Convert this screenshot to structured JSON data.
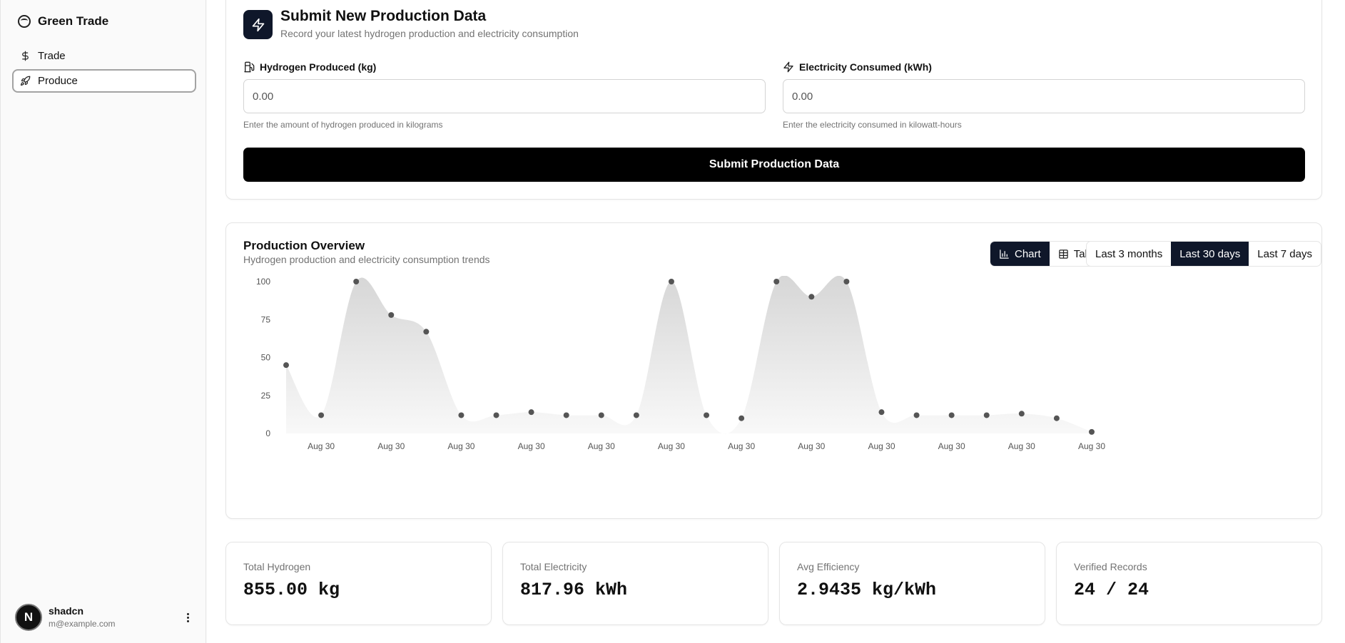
{
  "sidebar": {
    "brand": "Green Trade",
    "items": [
      {
        "label": "Trade",
        "icon": "dollar-icon"
      },
      {
        "label": "Produce",
        "icon": "rocket-icon",
        "active": true
      }
    ],
    "user": {
      "initial": "N",
      "name": "shadcn",
      "email": "m@example.com"
    }
  },
  "submit": {
    "title": "Submit New Production Data",
    "subtitle": "Record your latest hydrogen production and electricity consumption",
    "hydrogen": {
      "label": "Hydrogen Produced (kg)",
      "placeholder": "0.00",
      "help": "Enter the amount of hydrogen produced in kilograms"
    },
    "electricity": {
      "label": "Electricity Consumed (kWh)",
      "placeholder": "0.00",
      "help": "Enter the electricity consumed in kilowatt-hours"
    },
    "button": "Submit Production Data"
  },
  "overview": {
    "title": "Production Overview",
    "subtitle": "Hydrogen production and electricity consumption trends",
    "views": [
      {
        "label": "Chart",
        "active": true
      },
      {
        "label": "Table",
        "active": false
      }
    ],
    "ranges": [
      {
        "label": "Last 3 months",
        "active": false
      },
      {
        "label": "Last 30 days",
        "active": true
      },
      {
        "label": "Last 7 days",
        "active": false
      }
    ]
  },
  "chart_data": {
    "type": "area",
    "title": "",
    "xlabel": "",
    "ylabel": "",
    "ylim": [
      0,
      100
    ],
    "yticks": [
      0,
      25,
      50,
      75,
      100
    ],
    "x_tick_labels": [
      "Aug 30",
      "Aug 30",
      "Aug 30",
      "Aug 30",
      "Aug 30",
      "Aug 30",
      "Aug 30",
      "Aug 30",
      "Aug 30",
      "Aug 30",
      "Aug 30",
      "Aug 30"
    ],
    "series": [
      {
        "values": [
          45,
          12,
          100,
          78,
          67,
          12,
          12,
          14,
          12,
          12,
          12,
          100,
          12,
          10,
          100,
          90,
          100,
          14,
          12,
          12,
          12,
          13,
          10,
          1
        ]
      }
    ],
    "grid": false,
    "color": "#d4d4d4",
    "point_color": "#555555"
  },
  "stats": [
    {
      "label": "Total Hydrogen",
      "value": "855.00 kg"
    },
    {
      "label": "Total Electricity",
      "value": "817.96 kWh"
    },
    {
      "label": "Avg Efficiency",
      "value": "2.9435 kg/kWh"
    },
    {
      "label": "Verified Records",
      "value": "24 / 24"
    }
  ]
}
